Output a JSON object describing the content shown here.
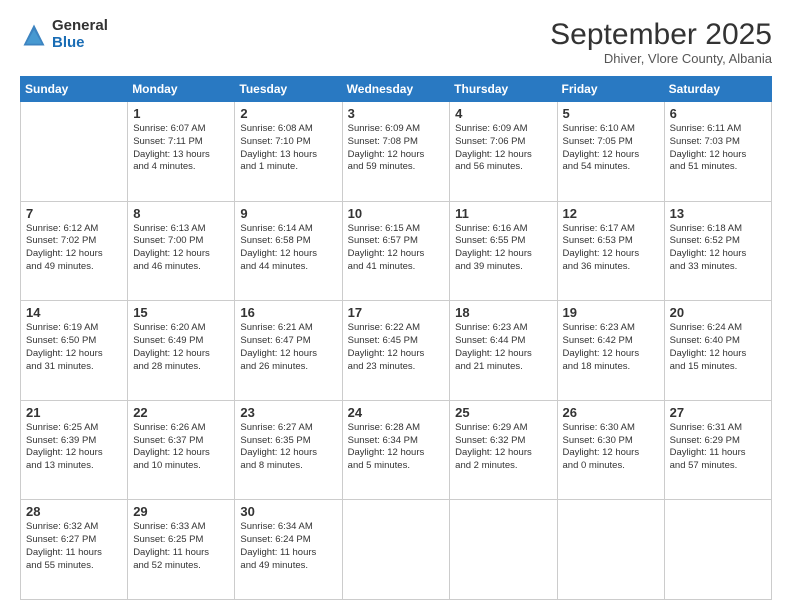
{
  "logo": {
    "general": "General",
    "blue": "Blue"
  },
  "title": "September 2025",
  "subtitle": "Dhiver, Vlore County, Albania",
  "days_of_week": [
    "Sunday",
    "Monday",
    "Tuesday",
    "Wednesday",
    "Thursday",
    "Friday",
    "Saturday"
  ],
  "weeks": [
    [
      {
        "day": "",
        "info": ""
      },
      {
        "day": "1",
        "info": "Sunrise: 6:07 AM\nSunset: 7:11 PM\nDaylight: 13 hours\nand 4 minutes."
      },
      {
        "day": "2",
        "info": "Sunrise: 6:08 AM\nSunset: 7:10 PM\nDaylight: 13 hours\nand 1 minute."
      },
      {
        "day": "3",
        "info": "Sunrise: 6:09 AM\nSunset: 7:08 PM\nDaylight: 12 hours\nand 59 minutes."
      },
      {
        "day": "4",
        "info": "Sunrise: 6:09 AM\nSunset: 7:06 PM\nDaylight: 12 hours\nand 56 minutes."
      },
      {
        "day": "5",
        "info": "Sunrise: 6:10 AM\nSunset: 7:05 PM\nDaylight: 12 hours\nand 54 minutes."
      },
      {
        "day": "6",
        "info": "Sunrise: 6:11 AM\nSunset: 7:03 PM\nDaylight: 12 hours\nand 51 minutes."
      }
    ],
    [
      {
        "day": "7",
        "info": "Sunrise: 6:12 AM\nSunset: 7:02 PM\nDaylight: 12 hours\nand 49 minutes."
      },
      {
        "day": "8",
        "info": "Sunrise: 6:13 AM\nSunset: 7:00 PM\nDaylight: 12 hours\nand 46 minutes."
      },
      {
        "day": "9",
        "info": "Sunrise: 6:14 AM\nSunset: 6:58 PM\nDaylight: 12 hours\nand 44 minutes."
      },
      {
        "day": "10",
        "info": "Sunrise: 6:15 AM\nSunset: 6:57 PM\nDaylight: 12 hours\nand 41 minutes."
      },
      {
        "day": "11",
        "info": "Sunrise: 6:16 AM\nSunset: 6:55 PM\nDaylight: 12 hours\nand 39 minutes."
      },
      {
        "day": "12",
        "info": "Sunrise: 6:17 AM\nSunset: 6:53 PM\nDaylight: 12 hours\nand 36 minutes."
      },
      {
        "day": "13",
        "info": "Sunrise: 6:18 AM\nSunset: 6:52 PM\nDaylight: 12 hours\nand 33 minutes."
      }
    ],
    [
      {
        "day": "14",
        "info": "Sunrise: 6:19 AM\nSunset: 6:50 PM\nDaylight: 12 hours\nand 31 minutes."
      },
      {
        "day": "15",
        "info": "Sunrise: 6:20 AM\nSunset: 6:49 PM\nDaylight: 12 hours\nand 28 minutes."
      },
      {
        "day": "16",
        "info": "Sunrise: 6:21 AM\nSunset: 6:47 PM\nDaylight: 12 hours\nand 26 minutes."
      },
      {
        "day": "17",
        "info": "Sunrise: 6:22 AM\nSunset: 6:45 PM\nDaylight: 12 hours\nand 23 minutes."
      },
      {
        "day": "18",
        "info": "Sunrise: 6:23 AM\nSunset: 6:44 PM\nDaylight: 12 hours\nand 21 minutes."
      },
      {
        "day": "19",
        "info": "Sunrise: 6:23 AM\nSunset: 6:42 PM\nDaylight: 12 hours\nand 18 minutes."
      },
      {
        "day": "20",
        "info": "Sunrise: 6:24 AM\nSunset: 6:40 PM\nDaylight: 12 hours\nand 15 minutes."
      }
    ],
    [
      {
        "day": "21",
        "info": "Sunrise: 6:25 AM\nSunset: 6:39 PM\nDaylight: 12 hours\nand 13 minutes."
      },
      {
        "day": "22",
        "info": "Sunrise: 6:26 AM\nSunset: 6:37 PM\nDaylight: 12 hours\nand 10 minutes."
      },
      {
        "day": "23",
        "info": "Sunrise: 6:27 AM\nSunset: 6:35 PM\nDaylight: 12 hours\nand 8 minutes."
      },
      {
        "day": "24",
        "info": "Sunrise: 6:28 AM\nSunset: 6:34 PM\nDaylight: 12 hours\nand 5 minutes."
      },
      {
        "day": "25",
        "info": "Sunrise: 6:29 AM\nSunset: 6:32 PM\nDaylight: 12 hours\nand 2 minutes."
      },
      {
        "day": "26",
        "info": "Sunrise: 6:30 AM\nSunset: 6:30 PM\nDaylight: 12 hours\nand 0 minutes."
      },
      {
        "day": "27",
        "info": "Sunrise: 6:31 AM\nSunset: 6:29 PM\nDaylight: 11 hours\nand 57 minutes."
      }
    ],
    [
      {
        "day": "28",
        "info": "Sunrise: 6:32 AM\nSunset: 6:27 PM\nDaylight: 11 hours\nand 55 minutes."
      },
      {
        "day": "29",
        "info": "Sunrise: 6:33 AM\nSunset: 6:25 PM\nDaylight: 11 hours\nand 52 minutes."
      },
      {
        "day": "30",
        "info": "Sunrise: 6:34 AM\nSunset: 6:24 PM\nDaylight: 11 hours\nand 49 minutes."
      },
      {
        "day": "",
        "info": ""
      },
      {
        "day": "",
        "info": ""
      },
      {
        "day": "",
        "info": ""
      },
      {
        "day": "",
        "info": ""
      }
    ]
  ]
}
